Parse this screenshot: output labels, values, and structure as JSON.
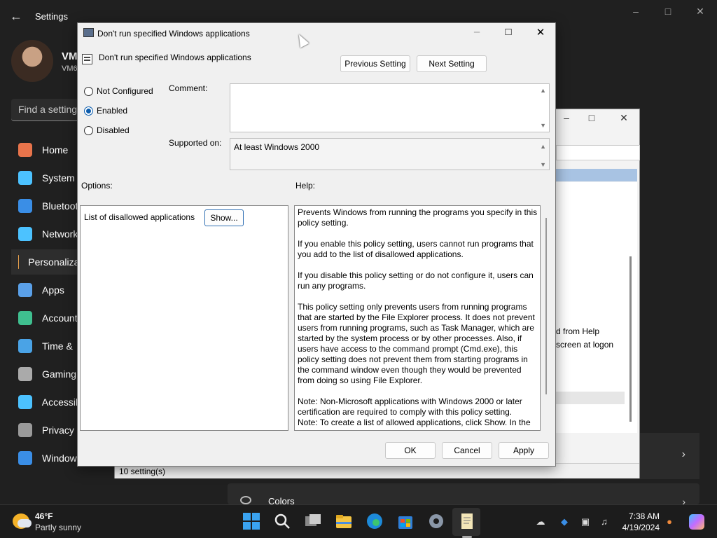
{
  "settings": {
    "app_title": "Settings",
    "user_name": "VM",
    "user_sub": "VM6",
    "search_placeholder": "Find a setting",
    "nav": [
      {
        "label": "Home",
        "icon": "home-icon",
        "color": "#e8744b"
      },
      {
        "label": "System",
        "icon": "monitor-icon",
        "color": "#4cc2ff"
      },
      {
        "label": "Bluetooth",
        "icon": "bluetooth-icon",
        "color": "#3a8ee6"
      },
      {
        "label": "Network",
        "icon": "wifi-icon",
        "color": "#4cc2ff"
      },
      {
        "label": "Personalization",
        "icon": "brush-icon",
        "color": "#e8a04b"
      },
      {
        "label": "Apps",
        "icon": "apps-icon",
        "color": "#5aa0e8"
      },
      {
        "label": "Accounts",
        "icon": "person-icon",
        "color": "#3fbf8f"
      },
      {
        "label": "Time &",
        "icon": "clock-globe-icon",
        "color": "#4aa3e6"
      },
      {
        "label": "Gaming",
        "icon": "gamepad-icon",
        "color": "#aaaaaa"
      },
      {
        "label": "Accessibility",
        "icon": "accessibility-icon",
        "color": "#4cc2ff"
      },
      {
        "label": "Privacy &",
        "icon": "shield-icon",
        "color": "#9a9a9a"
      },
      {
        "label": "Windows",
        "icon": "sync-icon",
        "color": "#3a8ee6"
      }
    ],
    "colors_label": "Colors"
  },
  "gpe": {
    "status": "10 setting(s)",
    "text_line1": "d from Help",
    "text_line2": "screen at logon"
  },
  "dialog": {
    "window_title": "Don't run specified Windows applications",
    "heading": "Don't run specified Windows applications",
    "prev_button": "Previous Setting",
    "next_button": "Next Setting",
    "radio_not_configured": "Not Configured",
    "radio_enabled": "Enabled",
    "radio_disabled": "Disabled",
    "comment_label": "Comment:",
    "comment_value": "",
    "supported_label": "Supported on:",
    "supported_value": "At least Windows 2000",
    "options_label": "Options:",
    "help_label": "Help:",
    "option_item": "List of disallowed applications",
    "show_button": "Show...",
    "help_p1": "Prevents Windows from running the programs you specify in this policy setting.",
    "help_p2": "If you enable this policy setting, users cannot run programs that you add to the list of disallowed applications.",
    "help_p3": "If you disable this policy setting or do not configure it, users can run any programs.",
    "help_p4": "This policy setting only prevents users from running programs that are started by the File Explorer process. It does not prevent users from running programs, such as Task Manager, which are started by the system process or by other processes.  Also, if users have access to the command prompt (Cmd.exe), this policy setting does not prevent them from starting programs in the command window even though they would be prevented from doing so using File Explorer.",
    "help_p5": "Note: Non-Microsoft applications with Windows 2000 or later certification are required to comply with this policy setting.",
    "help_p6": "Note: To create a list of allowed applications, click Show.  In the",
    "ok_button": "OK",
    "cancel_button": "Cancel",
    "apply_button": "Apply"
  },
  "taskbar": {
    "temperature": "46°F",
    "condition": "Partly sunny",
    "time": "7:38 AM",
    "date": "4/19/2024"
  }
}
